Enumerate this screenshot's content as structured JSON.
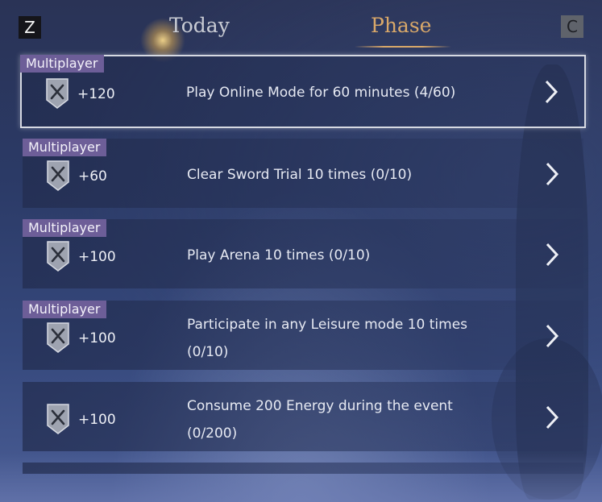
{
  "hotkeys": {
    "left": "Z",
    "right": "C"
  },
  "tabs": [
    {
      "label": "Today",
      "active": false
    },
    {
      "label": "Phase",
      "active": true
    }
  ],
  "colors": {
    "active_tab": "#d9a869",
    "tag_bg": "#6d5e98"
  },
  "quests": [
    {
      "tag": "Multiplayer",
      "reward": "+120",
      "description_lines": [
        "Play Online Mode for 60 minutes (4/60)"
      ],
      "selected": true,
      "icon": "shield-swords-icon"
    },
    {
      "tag": "Multiplayer",
      "reward": "+60",
      "description_lines": [
        "Clear Sword Trial 10 times (0/10)"
      ],
      "selected": false,
      "icon": "shield-swords-icon"
    },
    {
      "tag": "Multiplayer",
      "reward": "+100",
      "description_lines": [
        "Play Arena 10 times (0/10)"
      ],
      "selected": false,
      "icon": "shield-swords-icon"
    },
    {
      "tag": "Multiplayer",
      "reward": "+100",
      "description_lines": [
        "Participate in any Leisure mode 10 times",
        "(0/10)"
      ],
      "selected": false,
      "icon": "shield-swords-icon"
    },
    {
      "tag": "",
      "reward": "+100",
      "description_lines": [
        "Consume 200 Energy during the event",
        "(0/200)"
      ],
      "selected": false,
      "icon": "shield-swords-icon"
    }
  ]
}
